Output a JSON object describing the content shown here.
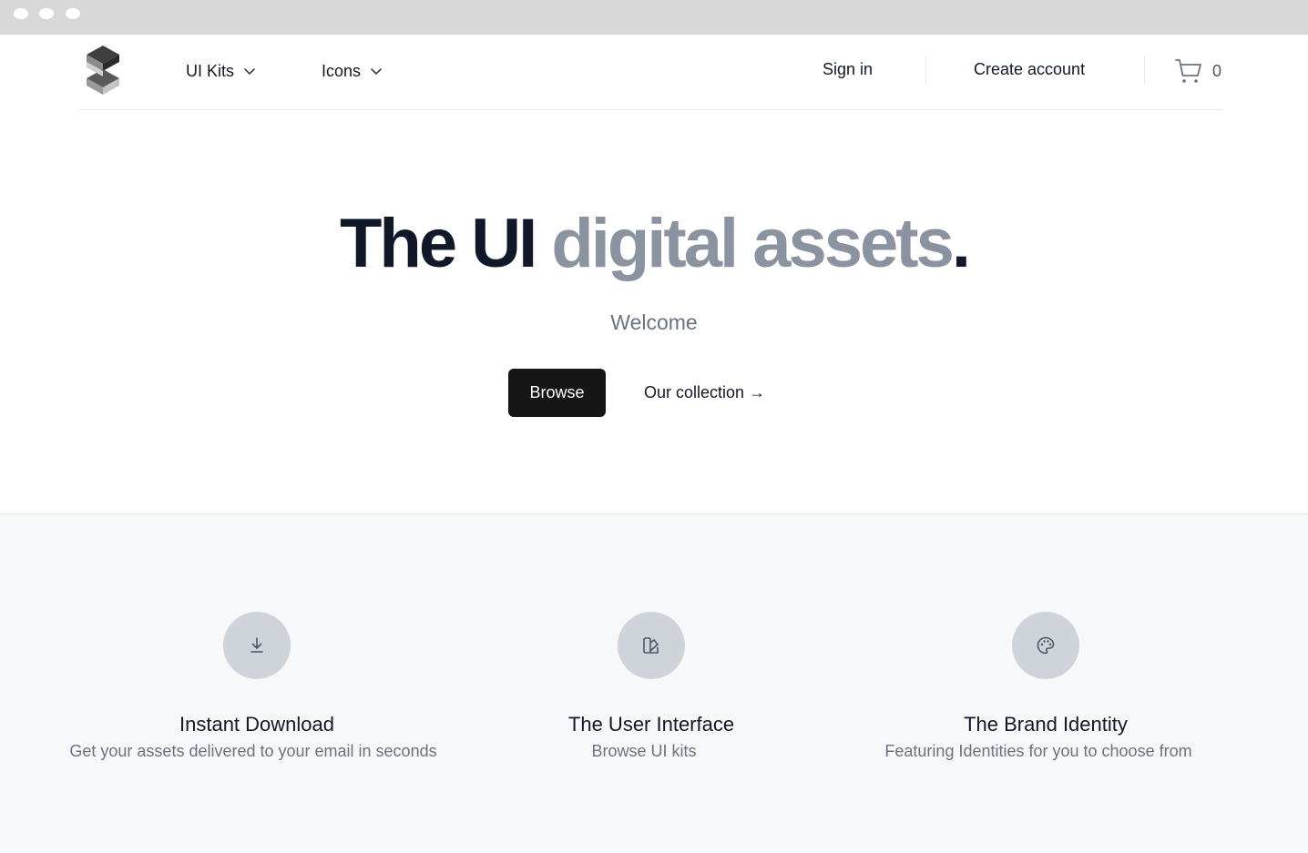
{
  "header": {
    "nav": [
      {
        "label": "UI Kits"
      },
      {
        "label": "Icons"
      }
    ],
    "sign_in": "Sign in",
    "create_account": "Create account",
    "cart_count": "0"
  },
  "hero": {
    "title_dark": "The UI",
    "title_gray": "digital assets",
    "title_period": ".",
    "subtitle": "Welcome",
    "primary_button": "Browse",
    "secondary_link": "Our collection →"
  },
  "features": [
    {
      "icon": "download-icon",
      "title": "Instant Download",
      "desc": "Get your assets delivered to your email in seconds"
    },
    {
      "icon": "swatch-book-icon",
      "title": "The User Interface",
      "desc": "Browse UI kits"
    },
    {
      "icon": "palette-icon",
      "title": "The Brand Identity",
      "desc": "Featuring Identities for you to choose from"
    }
  ],
  "colors": {
    "title_dark": "#111827",
    "title_gray": "#8b93a1",
    "button_bg": "#161616",
    "features_bg": "#f7f8fa",
    "icon_circle": "#cfd3da"
  }
}
